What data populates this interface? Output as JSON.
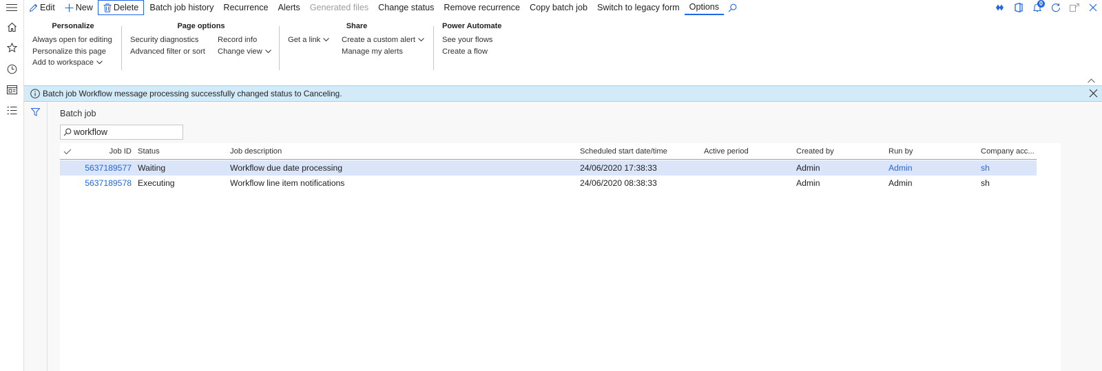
{
  "actions": {
    "edit": "Edit",
    "new": "New",
    "delete": "Delete",
    "batch_job_history": "Batch job history",
    "recurrence": "Recurrence",
    "alerts": "Alerts",
    "generated_files": "Generated files",
    "change_status": "Change status",
    "remove_recurrence": "Remove recurrence",
    "copy_batch_job": "Copy batch job",
    "switch_legacy": "Switch to legacy form",
    "options": "Options"
  },
  "notification_count": "0",
  "ribbon": {
    "personalize": {
      "title": "Personalize",
      "items": [
        "Always open for editing",
        "Personalize this page",
        "Add to workspace"
      ]
    },
    "page_options": {
      "title": "Page options",
      "col1": [
        "Security diagnostics",
        "Advanced filter or sort"
      ],
      "col2": [
        "Record info",
        "Change view"
      ]
    },
    "share": {
      "title": "Share",
      "col1": [
        "Get a link"
      ],
      "col2": [
        "Create a custom alert",
        "Manage my alerts"
      ]
    },
    "power_automate": {
      "title": "Power Automate",
      "items": [
        "See your flows",
        "Create a flow"
      ]
    }
  },
  "message": "Batch job Workflow message processing successfully changed status to Canceling.",
  "page_title": "Batch job",
  "search": {
    "value": "workflow"
  },
  "grid": {
    "columns": [
      "Job ID",
      "Status",
      "Job description",
      "Scheduled start date/time",
      "Active period",
      "Created by",
      "Run by",
      "Company acc..."
    ],
    "rows": [
      {
        "job_id": "5637189577",
        "status": "Waiting",
        "description": "Workflow due date processing",
        "scheduled": "24/06/2020 17:38:33",
        "active_period": "",
        "created_by": "Admin",
        "run_by": "Admin",
        "company": "sh"
      },
      {
        "job_id": "5637189578",
        "status": "Executing",
        "description": "Workflow line item notifications",
        "scheduled": "24/06/2020 08:38:33",
        "active_period": "",
        "created_by": "Admin",
        "run_by": "Admin",
        "company": "sh"
      }
    ]
  },
  "colors": {
    "accent": "#2266e3",
    "message_bar": "#d3ebf9",
    "selected_row": "#dbe5f9"
  }
}
